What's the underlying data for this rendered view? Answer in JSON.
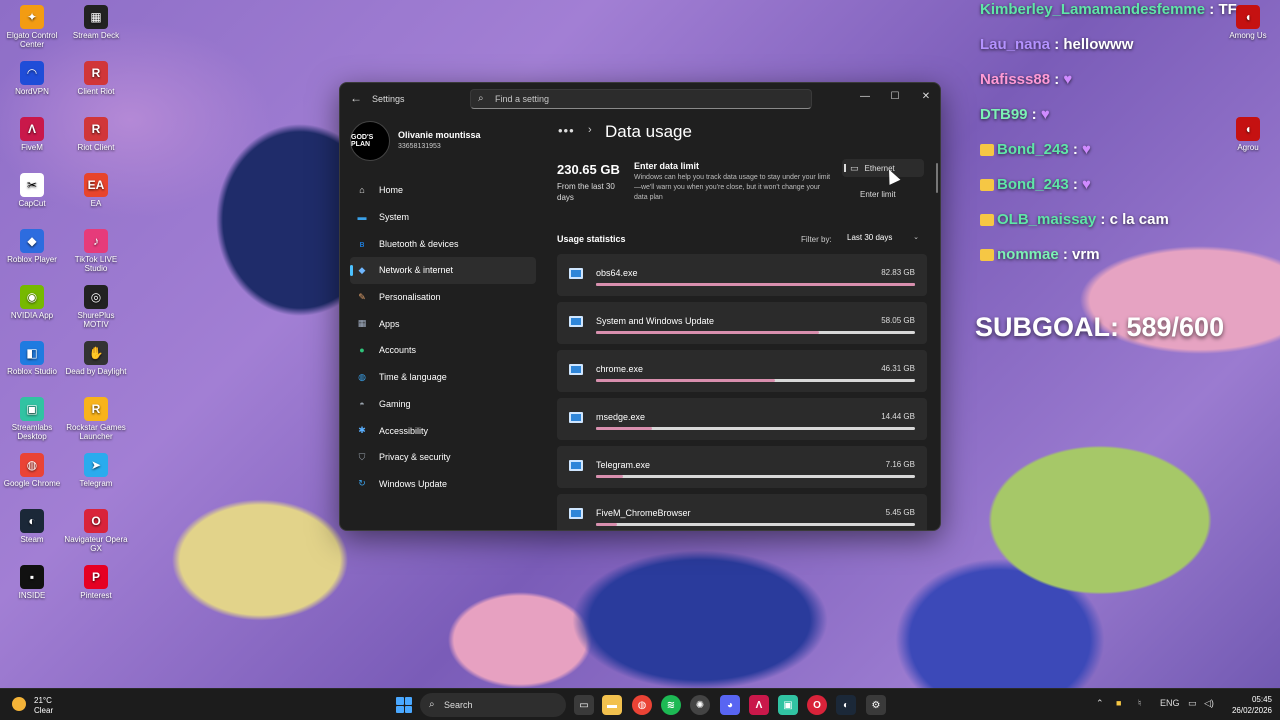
{
  "desktop": {
    "icons": [
      {
        "label": "Elgato Control Center",
        "color": "#f39c12",
        "glyph": "✦"
      },
      {
        "label": "Stream Deck",
        "color": "#222",
        "glyph": "▦"
      },
      {
        "label": "NordVPN",
        "color": "#1f4dd8",
        "glyph": "◠"
      },
      {
        "label": "Client Riot",
        "color": "#d13639",
        "glyph": "R"
      },
      {
        "label": "FiveM",
        "color": "#c9184a",
        "glyph": "Λ"
      },
      {
        "label": "Riot Client",
        "color": "#d13639",
        "glyph": "R"
      },
      {
        "label": "CapCut",
        "color": "#fff",
        "glyph": "✂"
      },
      {
        "label": "EA",
        "color": "#e8442c",
        "glyph": "EA"
      },
      {
        "label": "Roblox Player",
        "color": "#2d6cdf",
        "glyph": "◆"
      },
      {
        "label": "TikTok LIVE Studio",
        "color": "#e63b7a",
        "glyph": "♪"
      },
      {
        "label": "NVIDIA App",
        "color": "#76b900",
        "glyph": "◉"
      },
      {
        "label": "ShurePlus MOTIV",
        "color": "#222",
        "glyph": "◎"
      },
      {
        "label": "Roblox Studio",
        "color": "#1f7be0",
        "glyph": "◧"
      },
      {
        "label": "Dead by Daylight",
        "color": "#333",
        "glyph": "✋"
      },
      {
        "label": "Streamlabs Desktop",
        "color": "#31c3a2",
        "glyph": "▣"
      },
      {
        "label": "Rockstar Games Launcher",
        "color": "#f8b31b",
        "glyph": "R"
      },
      {
        "label": "Google Chrome",
        "color": "#ea4335",
        "glyph": "◍"
      },
      {
        "label": "Telegram",
        "color": "#2aabee",
        "glyph": "➤"
      },
      {
        "label": "Steam",
        "color": "#1b2838",
        "glyph": "◐"
      },
      {
        "label": "Navigateur Opera GX",
        "color": "#d9233a",
        "glyph": "O"
      },
      {
        "label": "INSIDE",
        "color": "#111",
        "glyph": "▪"
      },
      {
        "label": "Pinterest",
        "color": "#e60023",
        "glyph": "P"
      }
    ],
    "right_icons": [
      {
        "label": "Among Us",
        "color": "#c51111",
        "glyph": "◖"
      },
      {
        "label": "Agrou",
        "color": "#c51111",
        "glyph": "◖"
      }
    ]
  },
  "chat": [
    {
      "user": "Kimberley_Lamamandesfemme",
      "message": "TF",
      "user_class": "u1"
    },
    {
      "user": "Lau_nana",
      "message": "hellowww",
      "user_class": "u2"
    },
    {
      "user": "Nafisss88",
      "message": "♥",
      "user_class": "u3"
    },
    {
      "user": "DTB99",
      "message": "♥",
      "user_class": "u4"
    },
    {
      "user": "Bond_243",
      "message": "♥",
      "user_class": "u1"
    },
    {
      "user": "Bond_243",
      "message": "♥",
      "user_class": "u1"
    },
    {
      "user": "OLB_maissay",
      "message": "c la cam",
      "user_class": "u1"
    },
    {
      "user": "nommae",
      "message": "vrm",
      "user_class": "u4"
    }
  ],
  "subgoal": "SUBGOAL: 589/600",
  "settings": {
    "app_title": "Settings",
    "search_placeholder": "Find a setting",
    "profile": {
      "name": "Olivanie mountissa",
      "sub": "33658131953",
      "avatar_text": "GOD'S PLAN"
    },
    "nav": [
      {
        "label": "Home",
        "icon": "home-icon",
        "glyph": "⌂",
        "color": "#e8e8e8"
      },
      {
        "label": "System",
        "icon": "system-icon",
        "glyph": "▬",
        "color": "#3aa0e8"
      },
      {
        "label": "Bluetooth & devices",
        "icon": "bluetooth-icon",
        "glyph": "ʙ",
        "color": "#1e90ff"
      },
      {
        "label": "Network & internet",
        "icon": "network-icon",
        "glyph": "◆",
        "color": "#6fb7ff",
        "active": true
      },
      {
        "label": "Personalisation",
        "icon": "brush-icon",
        "glyph": "✎",
        "color": "#e5a36c"
      },
      {
        "label": "Apps",
        "icon": "apps-icon",
        "glyph": "▦",
        "color": "#a7b4c8"
      },
      {
        "label": "Accounts",
        "icon": "accounts-icon",
        "glyph": "●",
        "color": "#2fc37a"
      },
      {
        "label": "Time & language",
        "icon": "globe-icon",
        "glyph": "◍",
        "color": "#3aa0e8"
      },
      {
        "label": "Gaming",
        "icon": "gamepad-icon",
        "glyph": "◓",
        "color": "#9aa3ad"
      },
      {
        "label": "Accessibility",
        "icon": "accessibility-icon",
        "glyph": "✱",
        "color": "#5ab0ff"
      },
      {
        "label": "Privacy & security",
        "icon": "shield-icon",
        "glyph": "⛉",
        "color": "#9aa3ad"
      },
      {
        "label": "Windows Update",
        "icon": "update-icon",
        "glyph": "↻",
        "color": "#3aa0e8"
      }
    ],
    "breadcrumb_dots": "•••",
    "page_title": "Data usage",
    "total": "230.65 GB",
    "total_note": "From the last 30 days",
    "limit_title": "Enter data limit",
    "limit_desc": "Windows can help you track data usage to stay under your limit—we'll warn you when you're close, but it won't change your data plan",
    "ethernet_label": "Ethernet",
    "enter_limit": "Enter limit",
    "stats_label": "Usage statistics",
    "filter_label": "Filter by:",
    "filter_value": "Last 30 days",
    "apps": [
      {
        "name": "obs64.exe",
        "size": "82.83 GB",
        "fraction": 1.0
      },
      {
        "name": "System and Windows Update",
        "size": "58.05 GB",
        "fraction": 0.7
      },
      {
        "name": "chrome.exe",
        "size": "46.31 GB",
        "fraction": 0.56
      },
      {
        "name": "msedge.exe",
        "size": "14.44 GB",
        "fraction": 0.174
      },
      {
        "name": "Telegram.exe",
        "size": "7.16 GB",
        "fraction": 0.086
      },
      {
        "name": "FiveM_ChromeBrowser",
        "size": "5.45 GB",
        "fraction": 0.066
      }
    ]
  },
  "taskbar": {
    "temp": "21°C",
    "weather": "Clear",
    "search_label": "Search",
    "lang": "ENG",
    "time": "05:45",
    "date": "26/02/2026"
  }
}
